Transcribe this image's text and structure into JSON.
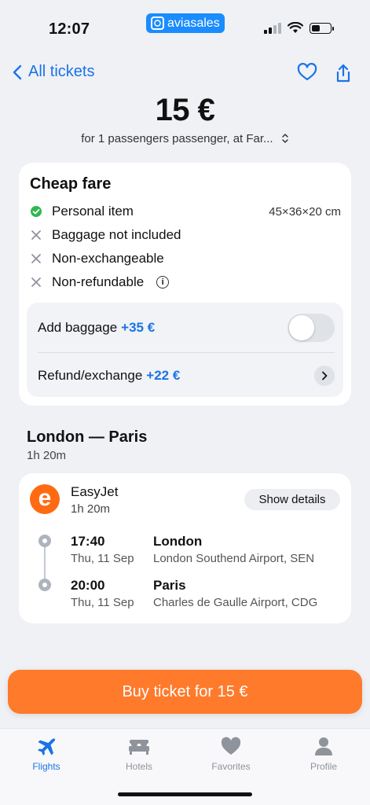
{
  "status": {
    "time": "12:07",
    "app_pill": "aviasales"
  },
  "nav": {
    "back_label": "All tickets"
  },
  "header": {
    "price": "15 €",
    "passengers": "for 1 passengers passenger, at Far..."
  },
  "fare": {
    "title": "Cheap fare",
    "features": [
      {
        "label": "Personal item",
        "detail": "45×36×20 cm",
        "icon": "check-circle-icon"
      },
      {
        "label": "Baggage not included",
        "icon": "cross-icon"
      },
      {
        "label": "Non-exchangeable",
        "icon": "cross-icon"
      },
      {
        "label": "Non-refundable",
        "icon": "cross-icon"
      }
    ],
    "addons": {
      "baggage_label": "Add baggage",
      "baggage_price": "+35 €",
      "baggage_enabled": false,
      "refund_label": "Refund/exchange",
      "refund_price": "+22 €"
    }
  },
  "route": {
    "title": "London — Paris",
    "duration": "1h 20m"
  },
  "flight": {
    "airline_name": "EasyJet",
    "airline_logo_letter": "e",
    "duration": "1h 20m",
    "details_label": "Show details",
    "departure": {
      "time": "17:40",
      "date": "Thu, 11 Sep",
      "city": "London",
      "airport": "London Southend Airport, SEN"
    },
    "arrival": {
      "time": "20:00",
      "date": "Thu, 11 Sep",
      "city": "Paris",
      "airport": "Charles de Gaulle Airport, CDG"
    }
  },
  "buy": {
    "label": "Buy ticket for 15 €"
  },
  "tabs": [
    {
      "label": "Flights",
      "active": true
    },
    {
      "label": "Hotels",
      "active": false
    },
    {
      "label": "Favorites",
      "active": false
    },
    {
      "label": "Profile",
      "active": false
    }
  ],
  "colors": {
    "accent": "#1a73e8",
    "buy": "#ff7a2b",
    "airline": "#ff6a13",
    "check": "#2fb84f"
  }
}
